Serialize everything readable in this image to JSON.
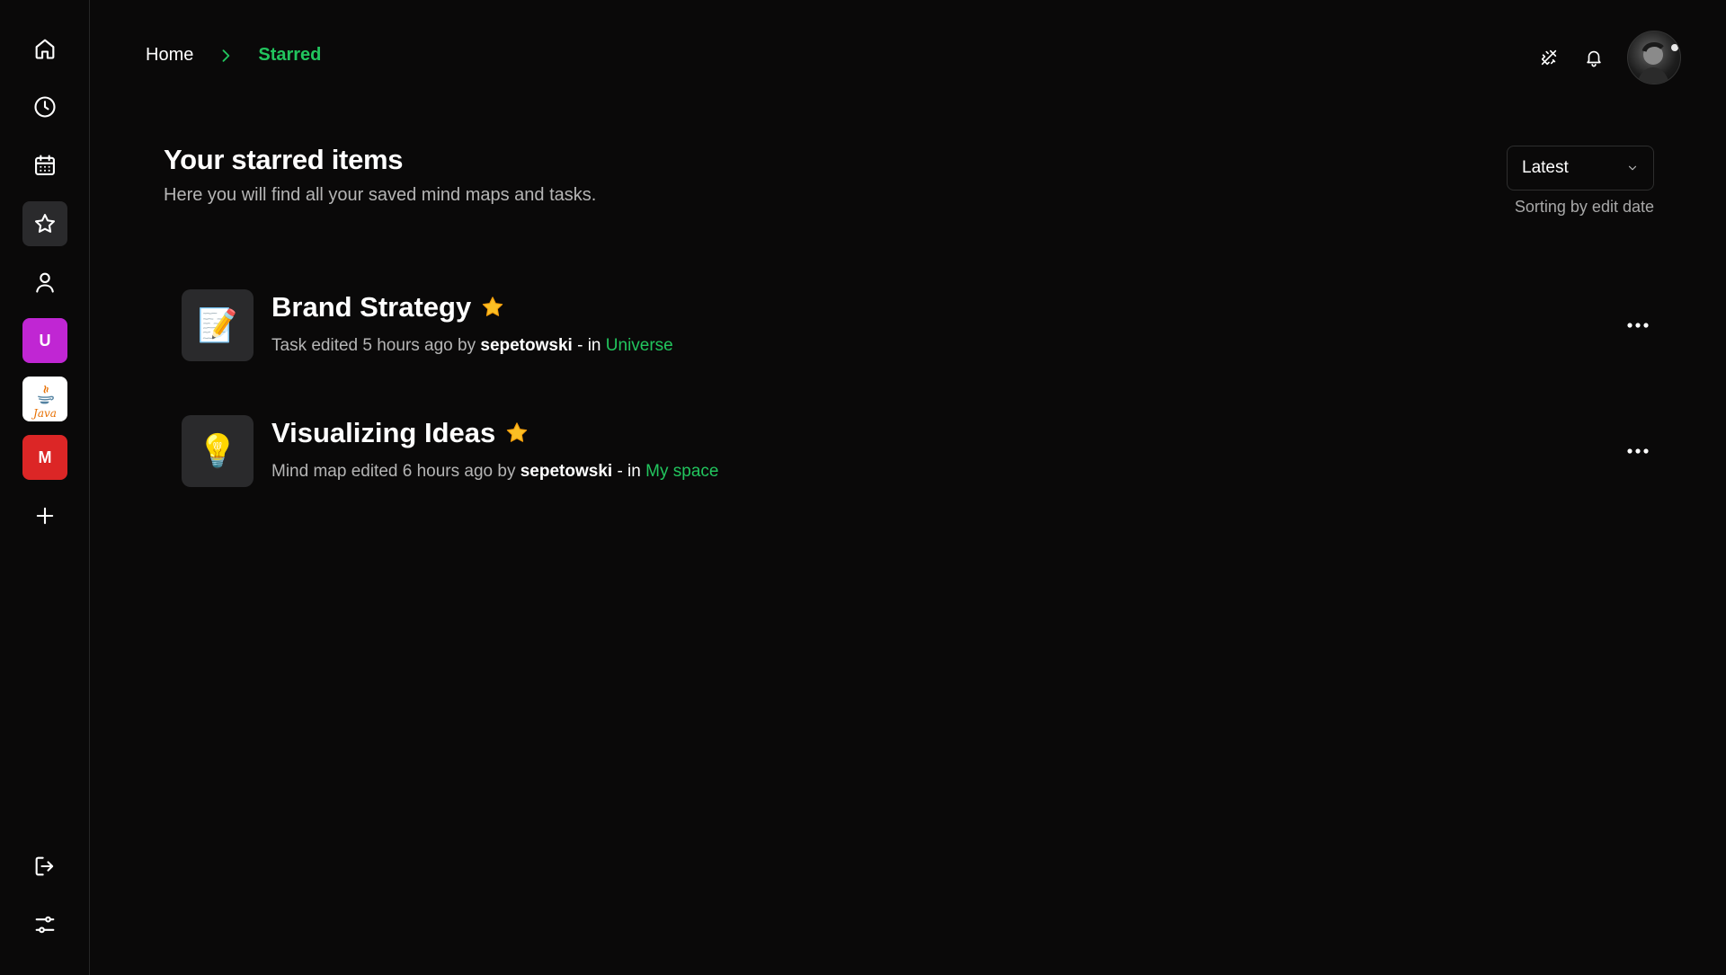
{
  "sidebar": {
    "nav": [
      {
        "name": "home",
        "icon": "home-icon"
      },
      {
        "name": "recent",
        "icon": "clock-icon"
      },
      {
        "name": "calendar",
        "icon": "calendar-icon"
      },
      {
        "name": "starred",
        "icon": "star-icon",
        "active": true
      },
      {
        "name": "profile",
        "icon": "user-icon"
      }
    ],
    "workspaces": [
      {
        "label": "U",
        "color": "#c026d3"
      },
      {
        "label": "Java",
        "color": "#ffffff"
      },
      {
        "label": "M",
        "color": "#dc2626"
      }
    ],
    "add_icon": "plus-icon",
    "bottom": [
      {
        "name": "logout",
        "icon": "logout-icon"
      },
      {
        "name": "settings",
        "icon": "sliders-icon"
      }
    ]
  },
  "breadcrumb": {
    "home": "Home",
    "current": "Starred"
  },
  "header": {
    "icons": [
      "magic-tools-icon",
      "bell-icon"
    ],
    "avatar": "avatar"
  },
  "page": {
    "title": "Your starred items",
    "subtitle": "Here you will find all your saved mind maps and tasks."
  },
  "sort": {
    "selected": "Latest",
    "caption": "Sorting by edit date"
  },
  "items": [
    {
      "title": "Brand Strategy",
      "icon_emoji": "📝",
      "meta_prefix": "Task edited 5 hours ago by",
      "user": "sepetowski",
      "meta_in": " - in",
      "space": "Universe"
    },
    {
      "title": "Visualizing Ideas",
      "icon_emoji": "💡",
      "meta_prefix": "Mind map edited 6 hours ago by",
      "user": "sepetowski",
      "meta_in": " - in",
      "space": "My space"
    }
  ],
  "colors": {
    "background": "#0a0909",
    "accent_green": "#22c55e",
    "star_yellow": "#fbbf24"
  }
}
